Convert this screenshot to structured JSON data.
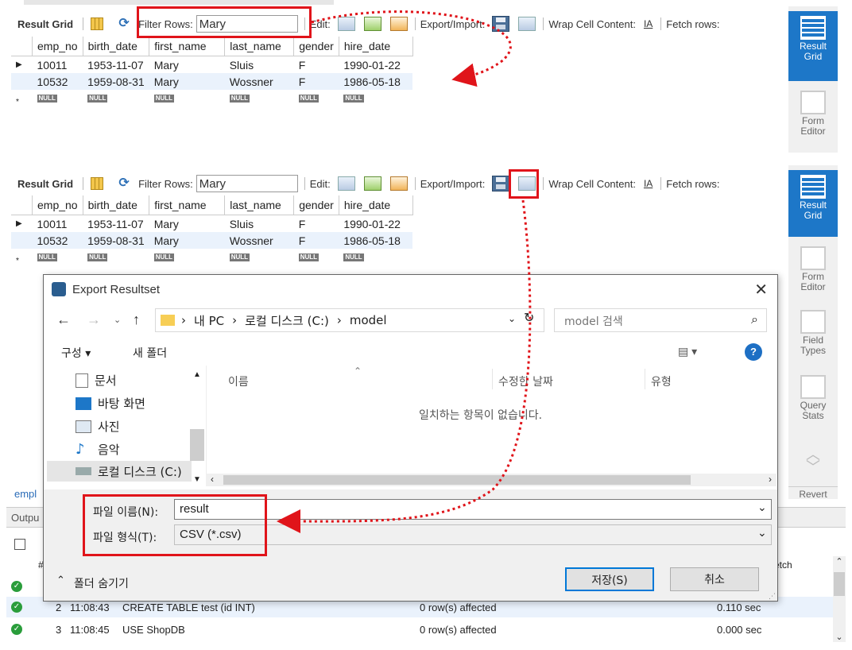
{
  "panel_top": {
    "toolbar": {
      "result_grid": "Result Grid",
      "filter_label": "Filter Rows:",
      "filter_value": "Mary",
      "edit_label": "Edit:",
      "export_label": "Export/Import:",
      "wrap_label": "Wrap Cell Content:",
      "fetch_label": "Fetch rows:"
    },
    "columns": [
      "emp_no",
      "birth_date",
      "first_name",
      "last_name",
      "gender",
      "hire_date"
    ],
    "rows": [
      [
        "10011",
        "1953-11-07",
        "Mary",
        "Sluis",
        "F",
        "1990-01-22"
      ],
      [
        "10532",
        "1959-08-31",
        "Mary",
        "Wossner",
        "F",
        "1986-05-18"
      ]
    ],
    "null_label": "NULL",
    "sidebar": {
      "result_grid": "Result\nGrid",
      "form_editor": "Form\nEditor"
    }
  },
  "panel_bottom": {
    "toolbar": {
      "result_grid": "Result Grid",
      "filter_label": "Filter Rows:",
      "filter_value": "Mary",
      "edit_label": "Edit:",
      "export_label": "Export/Import:",
      "wrap_label": "Wrap Cell Content:",
      "fetch_label": "Fetch rows:"
    },
    "columns": [
      "emp_no",
      "birth_date",
      "first_name",
      "last_name",
      "gender",
      "hire_date"
    ],
    "rows": [
      [
        "10011",
        "1953-11-07",
        "Mary",
        "Sluis",
        "F",
        "1990-01-22"
      ],
      [
        "10532",
        "1959-08-31",
        "Mary",
        "Wossner",
        "F",
        "1986-05-18"
      ]
    ],
    "null_label": "NULL",
    "sidebar": {
      "result_grid": "Result\nGrid",
      "form_editor": "Form\nEditor",
      "field_types": "Field\nTypes",
      "query_stats": "Query\nStats",
      "revert": "Revert"
    },
    "left_label": "empl",
    "output_label": "Outpu"
  },
  "dialog": {
    "title": "Export Resultset",
    "breadcrumb": [
      "내 PC",
      "로컬 디스크 (C:)",
      "model"
    ],
    "search_placeholder": "model 검색",
    "organize": "구성 ▾",
    "new_folder": "새 폴더",
    "nav_items": [
      "문서",
      "바탕 화면",
      "사진",
      "음악",
      "로컬 디스크 (C:)"
    ],
    "col_name": "이름",
    "col_modified": "수정한 날짜",
    "col_type": "유형",
    "empty_message": "일치하는 항목이 없습니다.",
    "filename_label": "파일 이름(N):",
    "filename_value": "result",
    "filetype_label": "파일 형식(T):",
    "filetype_value": "CSV (*.csv)",
    "hide_folders": "폴더 숨기기",
    "save": "저장(S)",
    "cancel": "취소"
  },
  "output": {
    "fetch_header": "etch",
    "hash_header": "#",
    "rows": [
      {
        "num": "2",
        "time": "11:08:43",
        "action": "CREATE TABLE test (id INT)",
        "message": "0 row(s) affected",
        "duration": "0.110 sec"
      },
      {
        "num": "3",
        "time": "11:08:45",
        "action": "USE ShopDB",
        "message": "0 row(s) affected",
        "duration": "0.000 sec"
      }
    ]
  },
  "colors": {
    "accent": "#1d77c8",
    "highlight": "#e0141a",
    "grid_selected": "#eaf2fc"
  }
}
